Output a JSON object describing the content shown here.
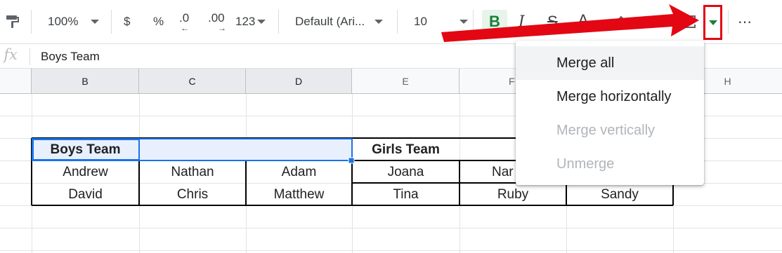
{
  "toolbar": {
    "zoom": "100%",
    "currency": "$",
    "percent": "%",
    "decrease_decimal": ".0",
    "increase_decimal": ".00",
    "number_format": "123",
    "font_family": "Default (Ari...",
    "font_size": "10",
    "bold": "B",
    "italic": "I",
    "strikethrough": "S",
    "text_color": "A",
    "more": "⋯"
  },
  "formula_bar": {
    "fx": "fx",
    "content": "Boys Team"
  },
  "columns": [
    "B",
    "C",
    "D",
    "E",
    "F",
    "H"
  ],
  "cells": {
    "boys_team": "Boys Team",
    "girls_team": "Girls Team",
    "row_a": [
      "Andrew",
      "Nathan",
      "Adam",
      "Joana",
      "Nar"
    ],
    "row_b": [
      "David",
      "Chris",
      "Matthew",
      "Tina",
      "Ruby",
      "Sandy"
    ]
  },
  "merge_menu": {
    "items": [
      {
        "label": "Merge all",
        "state": "hover"
      },
      {
        "label": "Merge horizontally",
        "state": "enabled"
      },
      {
        "label": "Merge vertically",
        "state": "disabled"
      },
      {
        "label": "Unmerge",
        "state": "disabled"
      }
    ]
  },
  "colors": {
    "accent_green": "#188038",
    "selection_blue": "#1a73e8",
    "annotation_red": "#e30613"
  }
}
